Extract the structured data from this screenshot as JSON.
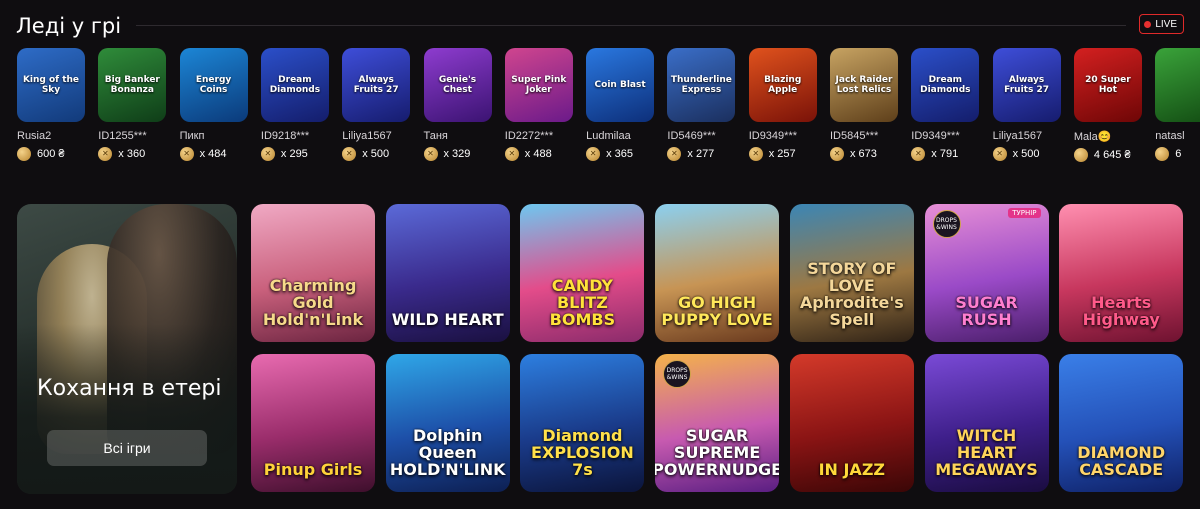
{
  "section": {
    "title": "Леді у грі",
    "live_label": "LIVE"
  },
  "winners": [
    {
      "game": "King of the Sky",
      "user": "Rusia2",
      "amount": "600 ₴",
      "coin": "plain",
      "bg": "linear-gradient(160deg,#2e6cc7,#123a7a)"
    },
    {
      "game": "Big Banker Bonanza",
      "user": "ID1255***",
      "amount": "x 360",
      "coin": "x",
      "bg": "linear-gradient(160deg,#2f8c3a,#0f3d18)"
    },
    {
      "game": "Energy Coins",
      "user": "Пикп",
      "amount": "x 484",
      "coin": "x",
      "bg": "linear-gradient(160deg,#1c86d6,#0b3a7a)"
    },
    {
      "game": "Dream Diamonds",
      "user": "ID9218***",
      "amount": "x 295",
      "coin": "x",
      "bg": "linear-gradient(160deg,#2b4fc9,#141d6b)"
    },
    {
      "game": "Always Fruits 27",
      "user": "Liliya1567",
      "amount": "x 500",
      "coin": "x",
      "bg": "linear-gradient(160deg,#3e4ed9,#161c6e)"
    },
    {
      "game": "Genie's Chest",
      "user": "Таня",
      "amount": "x 329",
      "coin": "x",
      "bg": "linear-gradient(160deg,#8e3ccf,#3b1372)"
    },
    {
      "game": "Super Pink Joker",
      "user": "ID2272***",
      "amount": "x 488",
      "coin": "x",
      "bg": "linear-gradient(160deg,#d0458e,#6b1a8a)"
    },
    {
      "game": "Coin Blast",
      "user": "Ludmilaa",
      "amount": "x 365",
      "coin": "x",
      "bg": "linear-gradient(160deg,#2a78e0,#0d2f7a)"
    },
    {
      "game": "Thunderline Express",
      "user": "ID5469***",
      "amount": "x 277",
      "coin": "x",
      "bg": "linear-gradient(160deg,#3a6ec8,#1b2f5e)"
    },
    {
      "game": "Blazing Apple",
      "user": "ID9349***",
      "amount": "x 257",
      "coin": "x",
      "bg": "linear-gradient(160deg,#e0521d,#7a1208)"
    },
    {
      "game": "Jack Raider Lost Relics",
      "user": "ID5845***",
      "amount": "x 673",
      "coin": "x",
      "bg": "linear-gradient(160deg,#c7a362,#5e3f1a)"
    },
    {
      "game": "Dream Diamonds",
      "user": "ID9349***",
      "amount": "x 791",
      "coin": "x",
      "bg": "linear-gradient(160deg,#2b4fc9,#141d6b)"
    },
    {
      "game": "Always Fruits 27",
      "user": "Liliya1567",
      "amount": "x 500",
      "coin": "x",
      "bg": "linear-gradient(160deg,#3e4ed9,#161c6e)"
    },
    {
      "game": "20 Super Hot",
      "user": "Mala😊",
      "amount": "4 645 ₴",
      "coin": "plain",
      "bg": "linear-gradient(160deg,#d42020,#6e0606)"
    },
    {
      "game": "",
      "user": "natasl",
      "amount": "6",
      "coin": "plain",
      "bg": "linear-gradient(160deg,#3aa33a,#124a12)"
    }
  ],
  "promo": {
    "title": "Кохання в етері",
    "button_label": "Всі ігри"
  },
  "games": [
    {
      "title": "Charming Gold Hold'n'Link",
      "color": "#f6d98a",
      "bg": "linear-gradient(170deg,#f0a9c4 0%,#c9607c 55%,#6b2440 100%)",
      "badge_dw": false,
      "badge_t": ""
    },
    {
      "title": "WILD HEART",
      "color": "#ffffff",
      "bg": "linear-gradient(170deg,#5b6ad8 0%,#3a2a8c 55%,#1a1040 100%)",
      "badge_dw": false,
      "badge_t": ""
    },
    {
      "title": "CANDY BLITZ BOMBS",
      "color": "#ffe23a",
      "bg": "linear-gradient(170deg,#6ec7f0 0%,#e34c8a 55%,#8a2b6b 100%)",
      "badge_dw": false,
      "badge_t": ""
    },
    {
      "title": "GO HIGH PUPPY LOVE",
      "color": "#ffe85a",
      "bg": "linear-gradient(170deg,#8bd0f0 0%,#c79454 55%,#6a3a1e 100%)",
      "badge_dw": false,
      "badge_t": ""
    },
    {
      "title": "STORY OF LOVE Aphrodite's Spell",
      "color": "#f4d79a",
      "bg": "linear-gradient(170deg,#3b86b5 0%,#9d7842 55%,#2f2216 100%)",
      "badge_dw": false,
      "badge_t": ""
    },
    {
      "title": "SUGAR RUSH",
      "color": "#ff7fd0",
      "bg": "linear-gradient(170deg,#e78fd6 0%,#9a4ac7 55%,#4a1e6a 100%)",
      "badge_dw": true,
      "badge_t": "ТУРНІР"
    },
    {
      "title": "Hearts Highway",
      "color": "#ff5a8a",
      "bg": "linear-gradient(170deg,#ff8fb0 0%,#c7375e 55%,#6e1230 100%)",
      "badge_dw": false,
      "badge_t": ""
    },
    {
      "title": "Pinup Girls",
      "color": "#ffd23a",
      "bg": "linear-gradient(170deg,#e86bb0 0%,#9a2d6b 55%,#3e0f2c 100%)",
      "badge_dw": false,
      "badge_t": ""
    },
    {
      "title": "Dolphin Queen HOLD'N'LINK",
      "color": "#ffffff",
      "bg": "linear-gradient(170deg,#2fa7e8 0%,#1d4fa8 55%,#0d1f52 100%)",
      "badge_dw": false,
      "badge_t": ""
    },
    {
      "title": "Diamond EXPLOSION 7s",
      "color": "#ffe04a",
      "bg": "linear-gradient(170deg,#2d7fe0 0%,#1a3b8a 55%,#0b143a 100%)",
      "badge_dw": false,
      "badge_t": ""
    },
    {
      "title": "SUGAR SUPREME POWERNUDGE",
      "color": "#ffffff",
      "bg": "linear-gradient(170deg,#f4b24a 0%,#c75ab0 55%,#5a1e82 100%)",
      "badge_dw": true,
      "badge_t": ""
    },
    {
      "title": "IN JAZZ",
      "color": "#ffd83a",
      "bg": "linear-gradient(170deg,#d43a2a 0%,#8a1414 55%,#3a0606 100%)",
      "badge_dw": false,
      "badge_t": ""
    },
    {
      "title": "WITCH HEART MEGAWAYS",
      "color": "#ffd45a",
      "bg": "linear-gradient(170deg,#7a4ad6 0%,#3e1f8a 55%,#1a0c40 100%)",
      "badge_dw": false,
      "badge_t": ""
    },
    {
      "title": "DIAMOND CASCADE",
      "color": "#ffd56a",
      "bg": "linear-gradient(170deg,#3a7fe8 0%,#2451b8 55%,#0f2166 100%)",
      "badge_dw": false,
      "badge_t": ""
    }
  ]
}
